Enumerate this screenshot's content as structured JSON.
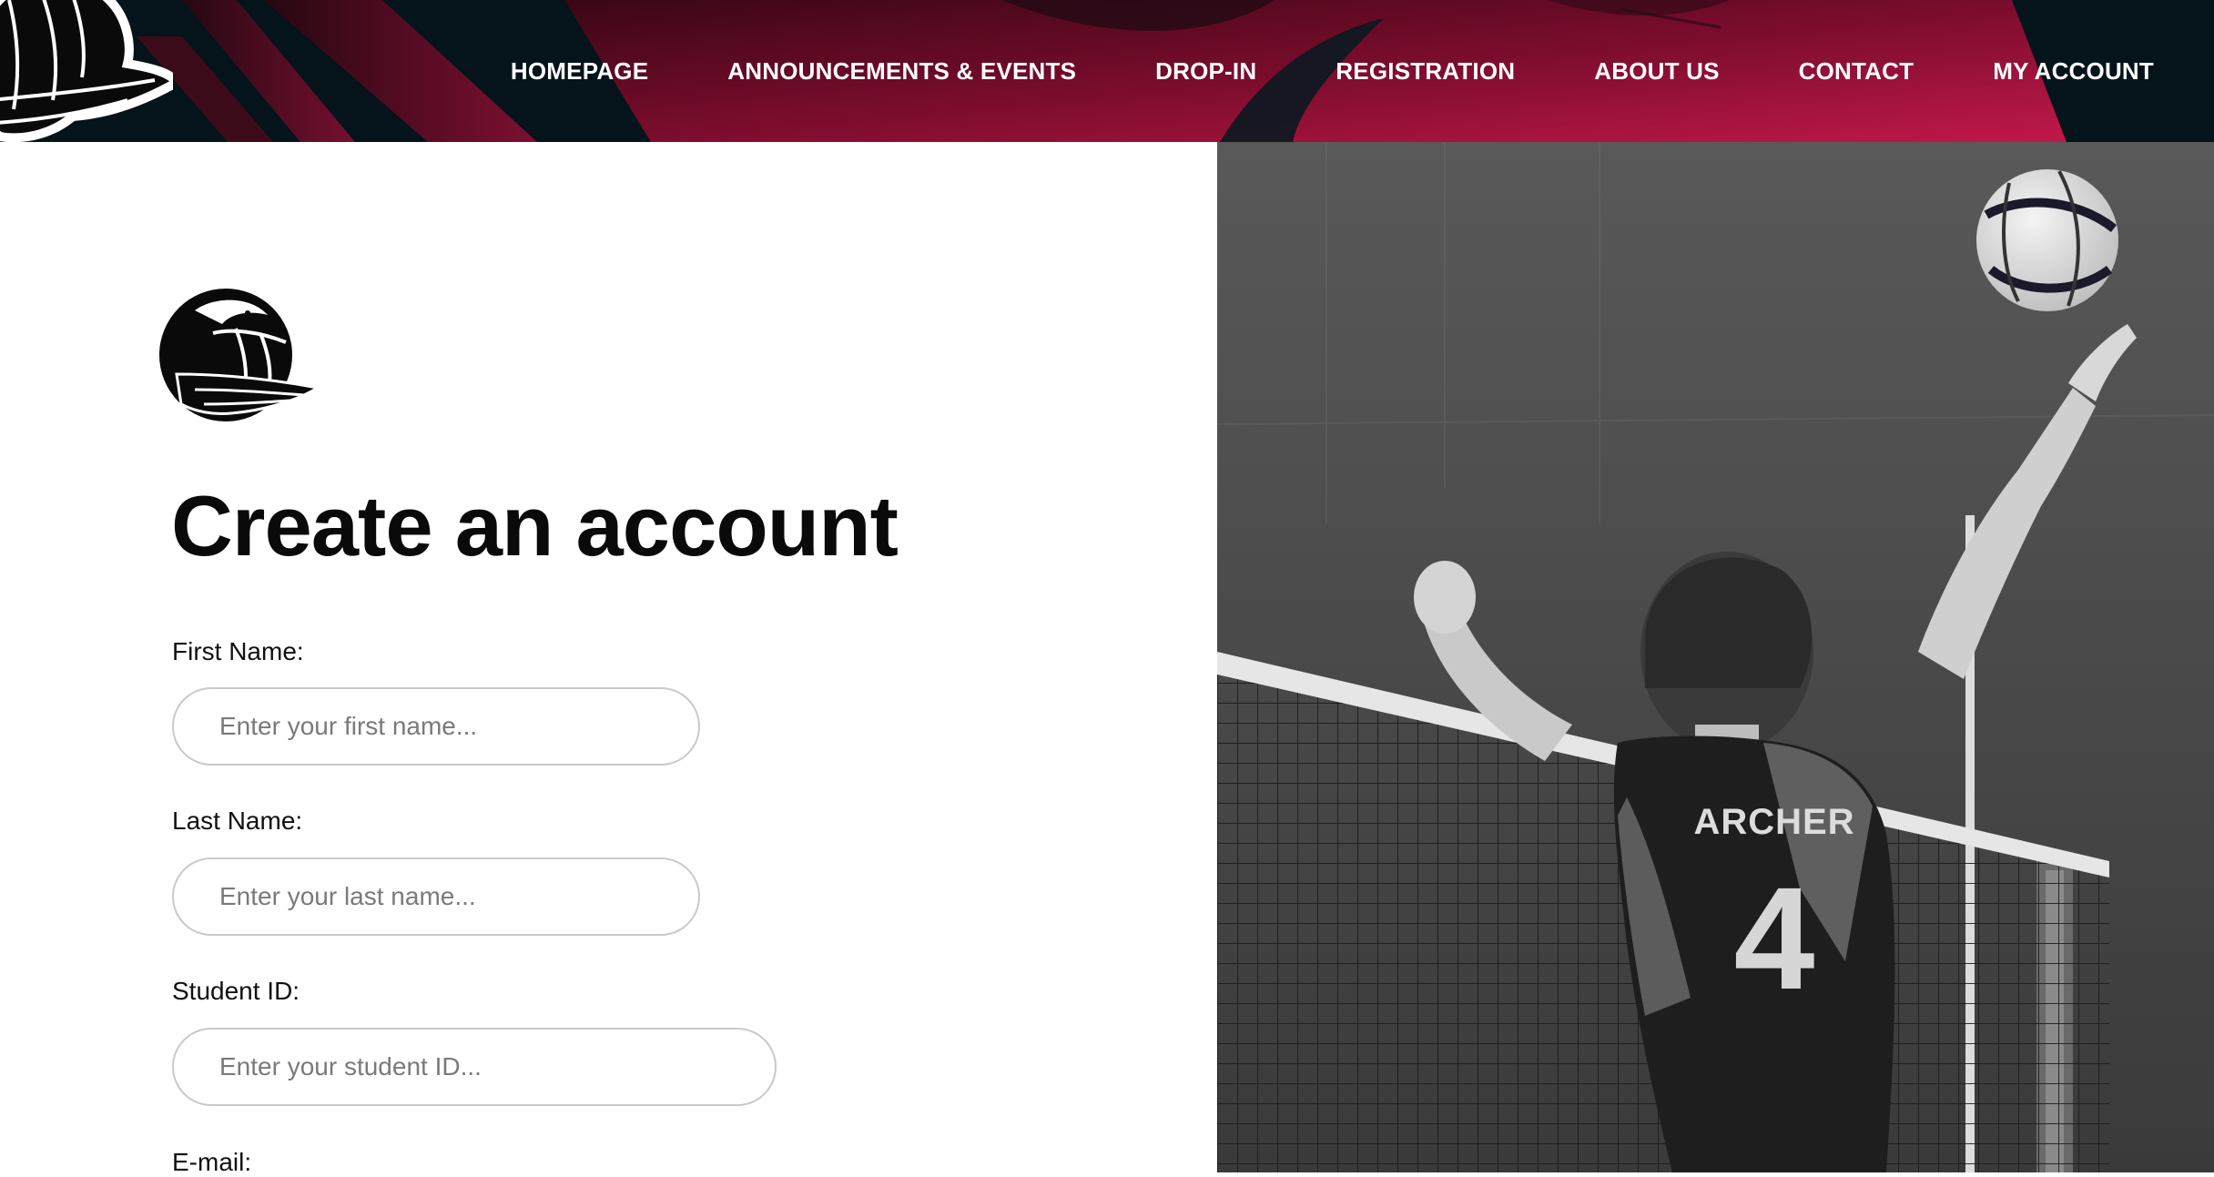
{
  "header": {
    "nav": [
      {
        "label": "HOMEPAGE"
      },
      {
        "label": "ANNOUNCEMENTS & EVENTS"
      },
      {
        "label": "DROP-IN"
      },
      {
        "label": "REGISTRATION"
      },
      {
        "label": "ABOUT US"
      },
      {
        "label": "CONTACT"
      },
      {
        "label": "MY ACCOUNT"
      }
    ],
    "colors": {
      "dark": "#05131a",
      "accent": "#b0143f"
    },
    "logo_icon": "volleyball-bird-logo-icon"
  },
  "form": {
    "logo_icon": "volleyball-bird-logo-icon",
    "title": "Create an account",
    "fields": [
      {
        "label": "First Name:",
        "placeholder": "Enter your first name..."
      },
      {
        "label": "Last Name:",
        "placeholder": "Enter your last name..."
      },
      {
        "label": "Student ID:",
        "placeholder": "Enter your student ID..."
      },
      {
        "label": "E-mail:"
      }
    ]
  },
  "photo": {
    "jersey_name": "ARCHER",
    "jersey_number": "4"
  }
}
